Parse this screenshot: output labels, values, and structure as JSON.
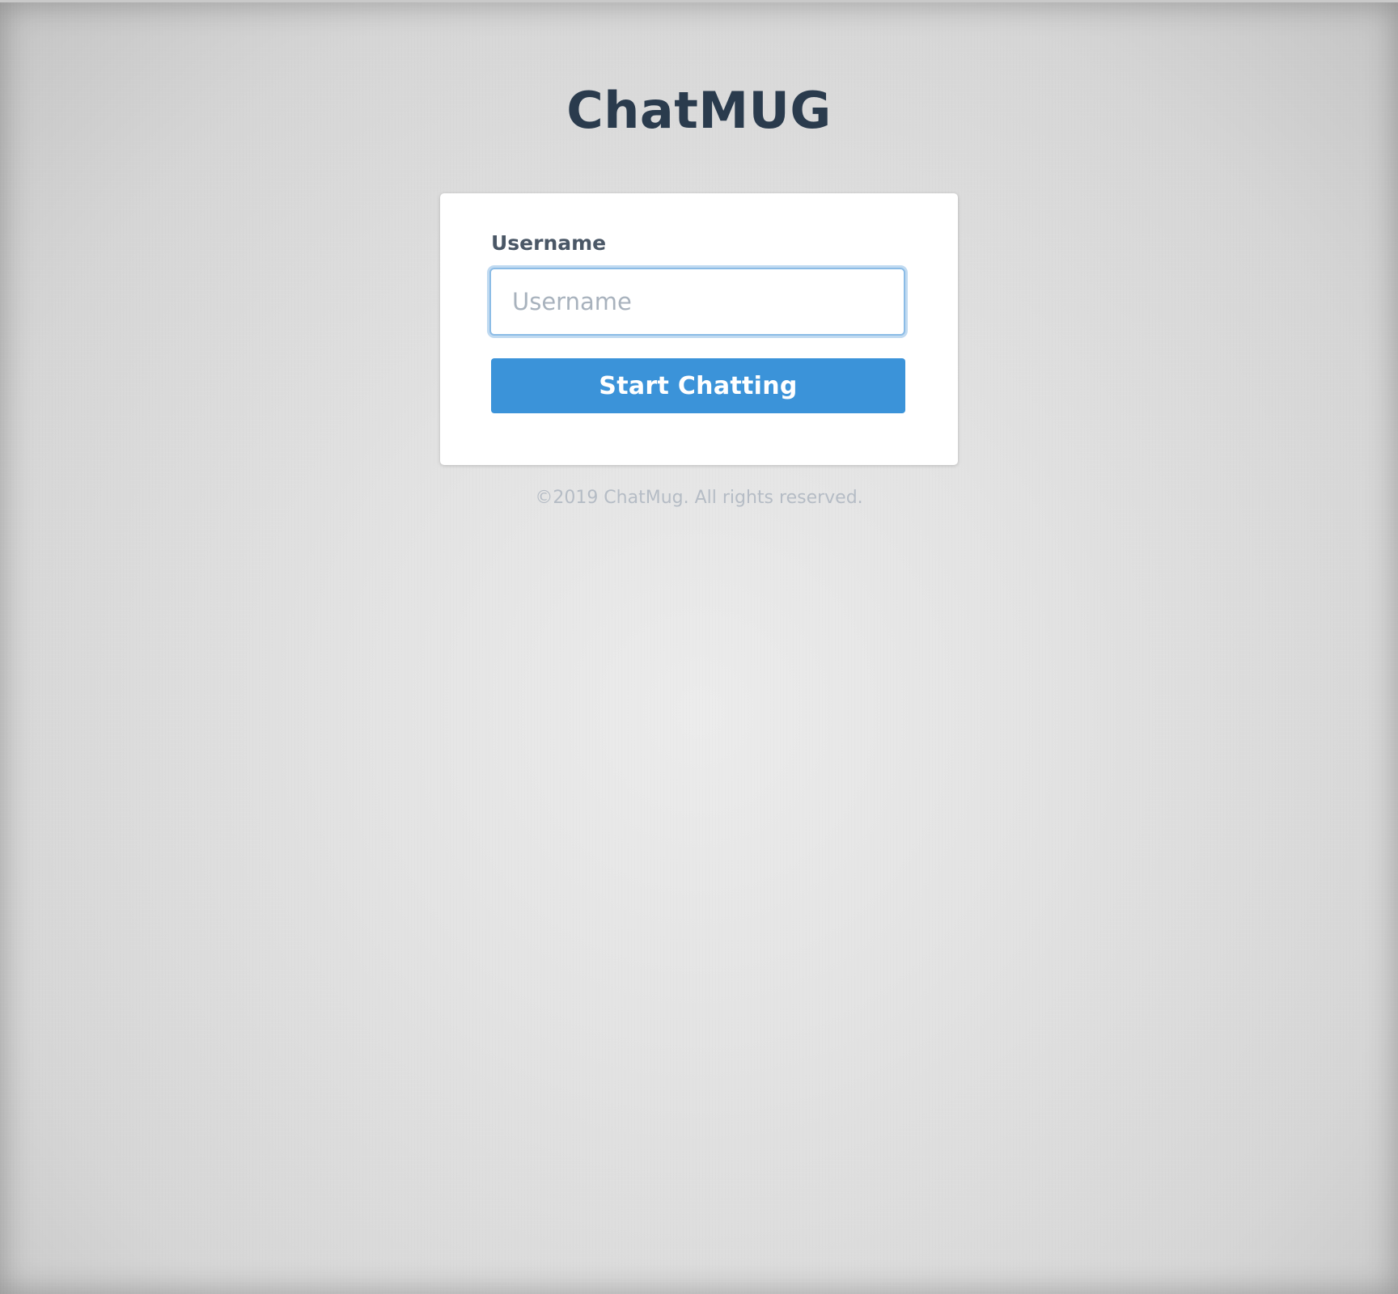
{
  "app": {
    "title": "ChatMUG"
  },
  "login": {
    "username_label": "Username",
    "username_placeholder": "Username",
    "username_value": "",
    "submit_label": "Start Chatting"
  },
  "footer": {
    "copyright": "©2019 ChatMug. All rights reserved."
  },
  "colors": {
    "title": "#2a3b4d",
    "button": "#3b93d9",
    "input_focus_border": "#8cbce6",
    "footer_text": "#b5bcc5"
  }
}
